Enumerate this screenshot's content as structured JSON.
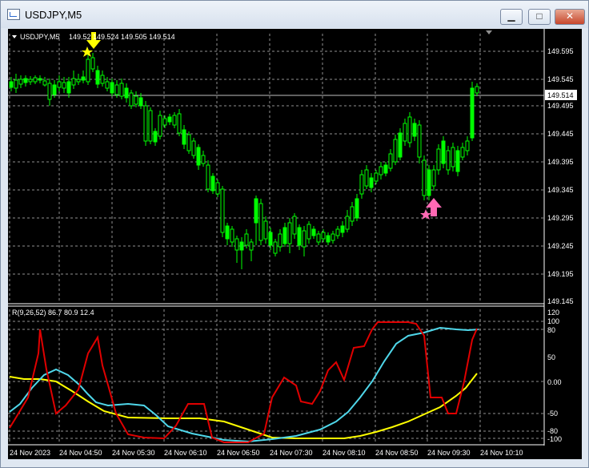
{
  "window": {
    "title": "USDJPY,M5",
    "minimize_label": "▁",
    "maximize_label": "□",
    "close_label": "✕"
  },
  "main_chart": {
    "symbol_label": "USDJPY,M5",
    "ohlc_label": "149.52   149.524 149.505 149.514",
    "price_axis": [
      "149.595",
      "149.545",
      "149.495",
      "149.445",
      "149.395",
      "149.345",
      "149.295",
      "149.245",
      "149.195",
      "149.145"
    ],
    "current_price": "149.514",
    "colors": {
      "background": "#000000",
      "candles": "#00ff00",
      "grid": "#ffffff"
    }
  },
  "indicator": {
    "label": "R(9,26,52) 86.7 80.9 12.4",
    "axis": [
      "120",
      "100",
      "80",
      "50",
      "0.00",
      "-50",
      "-80",
      "-100"
    ],
    "colors": {
      "red": "#e00000",
      "cyan": "#4fd7ea",
      "yellow": "#ffff00"
    }
  },
  "time_axis": [
    "24 Nov 2023",
    "24 Nov 04:50",
    "24 Nov 05:30",
    "24 Nov 06:10",
    "24 Nov 06:50",
    "24 Nov 07:30",
    "24 Nov 08:10",
    "24 Nov 08:50",
    "24 Nov 09:30",
    "24 Nov 10:10"
  ],
  "markers": {
    "sell_arrow_color": "#ffff00",
    "buy_arrow_color": "#ff69b4",
    "star_icons": [
      "yellow-star-icon",
      "pink-star-icon"
    ]
  }
}
